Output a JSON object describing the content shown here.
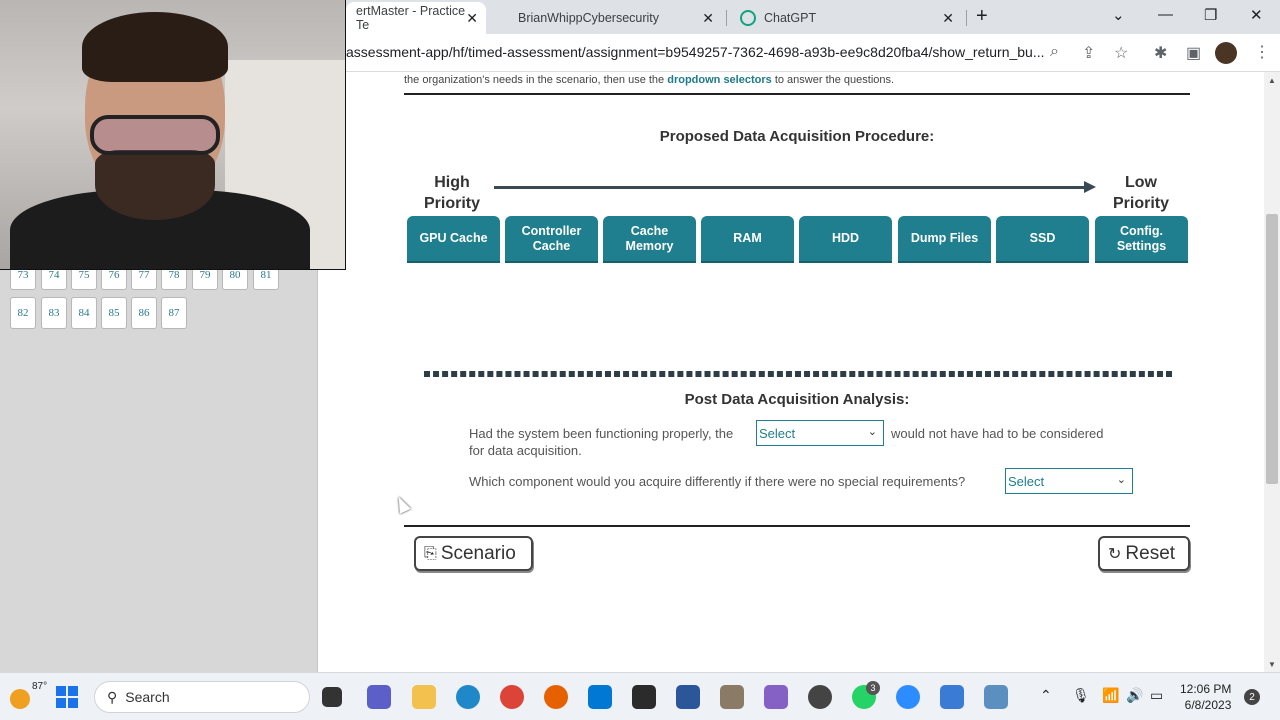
{
  "browser": {
    "tabs": [
      {
        "label": "ertMaster - Practice Te",
        "active": true
      },
      {
        "label": "BrianWhippCybersecurity",
        "active": false
      },
      {
        "label": "ChatGPT",
        "active": false
      }
    ],
    "url": "assessment-app/hf/timed-assessment/assignment=b9549257-7362-4698-a93b-ee9c8d20fba4/show_return_bu..."
  },
  "sidebar": {
    "partial_row": [
      "73",
      "74",
      "75",
      "76",
      "77",
      "78",
      "79",
      "80",
      "81"
    ],
    "row": [
      "82",
      "83",
      "84",
      "85",
      "86",
      "87"
    ]
  },
  "main": {
    "instruction_prefix": "the organization's needs in the scenario, then use the",
    "instruction_link": "dropdown selectors",
    "instruction_suffix": "to answer the questions.",
    "procedure_title": "Proposed Data Acquisition Procedure:",
    "high_priority_line1": "High",
    "high_priority_line2": "Priority",
    "low_priority_line1": "Low",
    "low_priority_line2": "Priority",
    "components": [
      {
        "line1": "GPU Cache",
        "line2": ""
      },
      {
        "line1": "Controller",
        "line2": "Cache"
      },
      {
        "line1": "Cache",
        "line2": "Memory"
      },
      {
        "line1": "RAM",
        "line2": ""
      },
      {
        "line1": "HDD",
        "line2": ""
      },
      {
        "line1": "Dump Files",
        "line2": ""
      },
      {
        "line1": "SSD",
        "line2": ""
      },
      {
        "line1": "Config.",
        "line2": "Settings"
      }
    ],
    "analysis_title": "Post Data Acquisition Analysis:",
    "q1_before": "Had the system been functioning properly, the",
    "q1_after": "would not have had to be considered",
    "q1_line2": "for data acquisition.",
    "q1_select": "Select",
    "q2_text": "Which component would you acquire differently if there were no special requirements?",
    "q2_select": "Select",
    "scenario_button": "Scenario",
    "reset_button": "Reset"
  },
  "taskbar": {
    "temperature": "87°",
    "search_label": "Search",
    "whatsapp_badge": "3",
    "time": "12:06 PM",
    "date": "6/8/2023",
    "notifications": "2"
  },
  "colors": {
    "accent": "#1f7f8e",
    "arrow": "#3a4a52"
  }
}
